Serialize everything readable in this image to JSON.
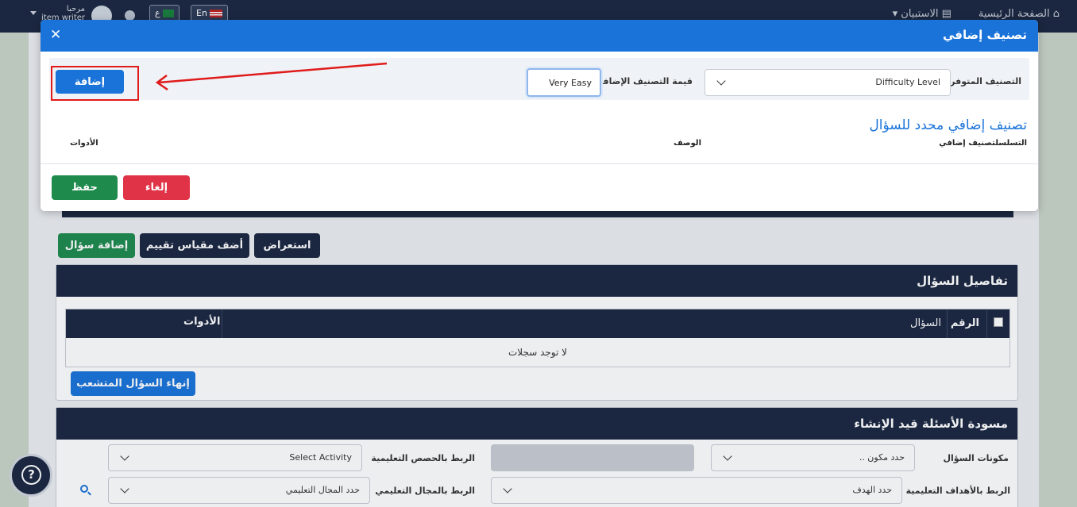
{
  "topbar": {
    "home": "الصفحة الرئيسية",
    "surveys": "الاستبيان",
    "lang_en": "En",
    "lang_ar": "ع",
    "greeting": "مرحبا",
    "username": "item writer"
  },
  "page": {
    "buttons": {
      "preview": "استعراض",
      "add_scale": "أضف مقياس تقييم",
      "add_question": "إضافة سؤال"
    },
    "question_details": {
      "title": "تفاصيل السؤال",
      "col_number": "الرقم",
      "col_question": "السؤال",
      "col_tools": "الأدوات",
      "empty": "لا توجد سجلات",
      "end_branch": "إنهاء السؤال المتشعب"
    },
    "drafts": {
      "title": "مسودة الأسئلة قيد الإنشاء",
      "components_label": "مكونات السؤال",
      "components_value": "حدد مكون ..",
      "lessons_label": "الربط بالحصص التعليمية",
      "activity_value": "Select Activity",
      "objectives_label": "الربط بالأهداف التعليمية",
      "objective_value": "حدد الهدف",
      "domain_label": "الربط بالمجال التعليمي",
      "domain_value": "حدد المجال التعليمي"
    }
  },
  "modal": {
    "title": "تصنيف إضافي",
    "available_label": "التصنيف المتوفر:",
    "available_value": "Difficulty Level",
    "value_label": "قيمة التصنيف الإضافي",
    "value_input": "Very Easy",
    "add_button": "إضافة",
    "section_title": "تصنيف إضافي محدد للسؤال",
    "col_sequence": "التسلسل",
    "col_classification": "تصنيف إضافي",
    "col_description": "الوصف",
    "col_tools": "الأدوات",
    "cancel_button": "إلغاء",
    "save_button": "حفظ"
  },
  "annotation": {
    "arrow_color": "#e01b1b"
  }
}
